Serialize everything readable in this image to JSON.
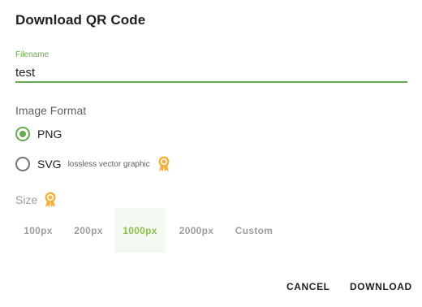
{
  "dialog": {
    "title": "Download QR Code",
    "filename": {
      "label": "Filename",
      "value": "test"
    },
    "image_format": {
      "label": "Image Format",
      "options": [
        {
          "label": "PNG",
          "selected": true
        },
        {
          "label": "SVG",
          "selected": false,
          "note": "lossless vector graphic",
          "badge_icon": "premium-badge-icon"
        }
      ]
    },
    "size": {
      "label": "Size",
      "badge_icon": "premium-badge-icon",
      "options": [
        "100px",
        "200px",
        "1000px",
        "2000px",
        "Custom"
      ],
      "selected": "1000px"
    },
    "actions": {
      "cancel": "CANCEL",
      "download": "DOWNLOAD"
    }
  },
  "colors": {
    "accent": "#6aa84f",
    "badge": "#f5b041",
    "muted": "#9e9e9e"
  }
}
